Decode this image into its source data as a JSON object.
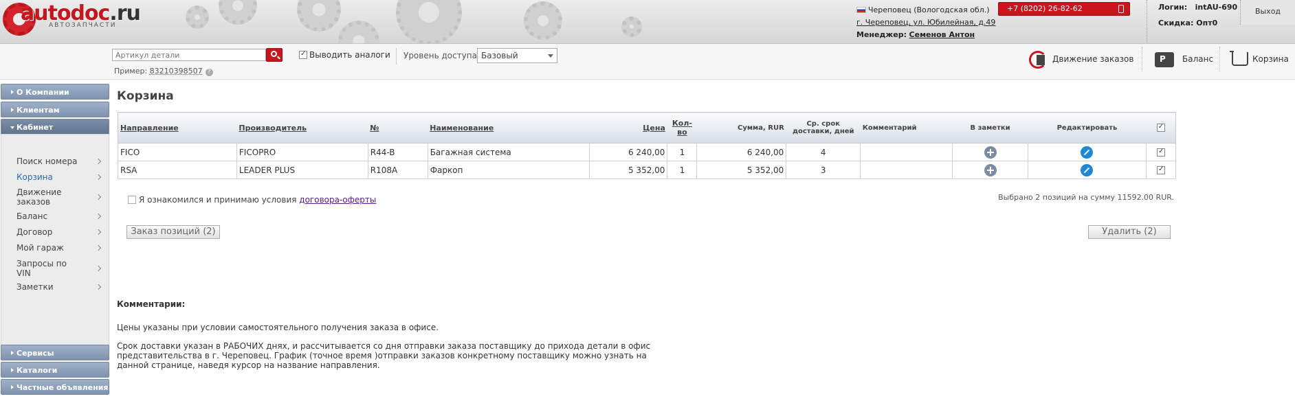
{
  "header": {
    "logo_main": "autodoc",
    "logo_ru": ".ru",
    "logo_sub": "АВТОЗАПЧАСТИ",
    "region": "Череповец (Вологодская обл.)",
    "address": "г. Череповец, ул. Юбилейная, д.49",
    "manager_label": "Менеджер:",
    "manager_name": "Семенов Антон",
    "phone": "+7 (8202) 26-82-62",
    "login_label": "Логин:",
    "login_value": "intAU-690",
    "discount_label": "Скидка:",
    "discount_value": "Опт0",
    "logout": "Выход"
  },
  "toolbar": {
    "search_placeholder": "Артикул детали",
    "example_label": "Пример:",
    "example_number": "83210398507",
    "help": "?",
    "analogs_label": "Выводить аналоги",
    "access_label": "Уровень доступа",
    "access_value": "Базовый",
    "orders_link": "Движение заказов",
    "balance_link": "Баланс",
    "cart_link": "Корзина"
  },
  "sidebar": {
    "sections_top": [
      "О Компании",
      "Клиентам",
      "Кабинет"
    ],
    "sub_items": [
      "Поиск номера",
      "Корзина",
      "Движение заказов",
      "Баланс",
      "Договор",
      "Мой гараж",
      "Запросы по VIN",
      "Заметки"
    ],
    "sections_bottom": [
      "Сервисы",
      "Каталоги",
      "Частные объявления"
    ]
  },
  "main": {
    "title": "Корзина",
    "columns": {
      "direction": "Направление",
      "manufacturer": "Производитель",
      "number": "№",
      "name": "Наименование",
      "price": "Цена",
      "qty": "Кол-во",
      "sum": "Сумма, RUR",
      "delivery": "Ср. срок доставки, дней",
      "comment": "Комментарий",
      "notes": "В заметки",
      "edit": "Редактировать"
    },
    "rows": [
      {
        "direction": "FICO",
        "manufacturer": "FICOPRO",
        "number": "R44-B",
        "name": "Багажная система",
        "price": "6 240,00",
        "qty": "1",
        "sum": "6 240,00",
        "delivery": "4",
        "comment": ""
      },
      {
        "direction": "RSA",
        "manufacturer": "LEADER PLUS",
        "number": "R108A",
        "name": "Фаркоп",
        "price": "5 352,00",
        "qty": "1",
        "sum": "5 352,00",
        "delivery": "3",
        "comment": ""
      }
    ],
    "agree_text": "Я ознакомился и принимаю условия",
    "agree_link": "договора-оферты",
    "selected_info": "Выбрано 2 позиций на сумму 11592.00 RUR.",
    "order_button": "Заказ позиций (2)",
    "delete_button": "Удалить (2)",
    "comments_title": "Комментарии:",
    "comment_1": "Цены указаны при условии самостоятельного получения заказа в офисе.",
    "comment_2": "Срок доставки указан в РАБОЧИХ днях, и рассчитывается со дня отправки заказа поставщику до прихода детали в офис представительства в г. Череповец. График (точное время )отправки заказов конкретному поставщику можно узнать на данной странице, наведя курсор на название направления."
  }
}
